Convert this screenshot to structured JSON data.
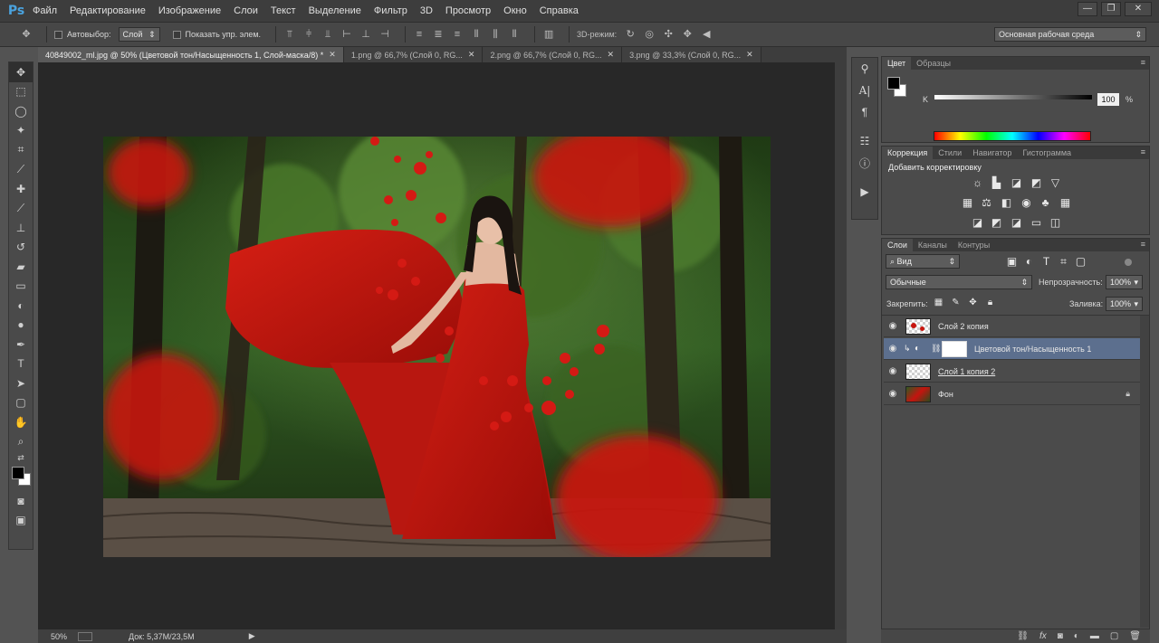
{
  "app": {
    "logo": "Ps"
  },
  "menu": [
    "Файл",
    "Редактирование",
    "Изображение",
    "Слои",
    "Текст",
    "Выделение",
    "Фильтр",
    "3D",
    "Просмотр",
    "Окно",
    "Справка"
  ],
  "window_controls": [
    "—",
    "❐",
    "✕"
  ],
  "options": {
    "autoselect_label": "Автовыбор:",
    "autoselect_value": "Слой",
    "show_controls_label": "Показать упр. элем.",
    "mode_3d_label": "3D-режим:",
    "workspace": "Основная рабочая среда"
  },
  "doc_tabs": [
    {
      "label": "40849002_ml.jpg @ 50% (Цветовой тон/Насыщенность 1, Слой-маска/8) *",
      "active": true
    },
    {
      "label": "1.png @ 66,7% (Слой 0, RG...",
      "active": false
    },
    {
      "label": "2.png @ 66,7% (Слой 0, RG...",
      "active": false
    },
    {
      "label": "3.png @ 33,3% (Слой 0, RG...",
      "active": false
    }
  ],
  "status": {
    "zoom": "50%",
    "doc_info": "Док: 5,37M/23,5M"
  },
  "color_panel": {
    "tabs": [
      "Цвет",
      "Образцы"
    ],
    "channel_label": "K",
    "channel_value": "100",
    "percent": "%"
  },
  "adjustments_panel": {
    "tabs": [
      "Коррекция",
      "Стили",
      "Навигатор",
      "Гистограмма"
    ],
    "title": "Добавить корректировку"
  },
  "layers_panel": {
    "tabs": [
      "Слои",
      "Каналы",
      "Контуры"
    ],
    "filter_kind": "Вид",
    "blend_mode": "Обычные",
    "opacity_label": "Непрозрачность:",
    "opacity_value": "100%",
    "lock_label": "Закрепить:",
    "fill_label": "Заливка:",
    "fill_value": "100%",
    "layers": [
      {
        "name": "Слой 2 копия",
        "selected": false
      },
      {
        "name": "Цветовой тон/Насыщенность 1",
        "selected": true
      },
      {
        "name": "Слой 1 копия 2",
        "selected": false
      },
      {
        "name": "Фон",
        "selected": false
      }
    ]
  },
  "colors": {
    "accent": "#4aa3df",
    "selected_layer": "#5c6f8e",
    "dress_red": "#c5140f"
  }
}
